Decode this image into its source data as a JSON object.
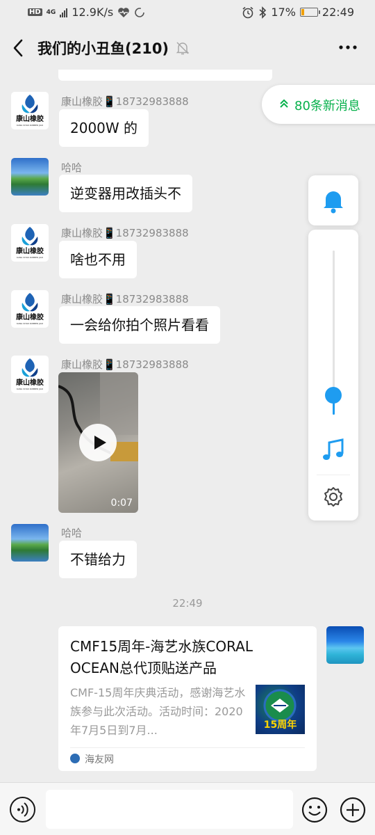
{
  "status_bar": {
    "network_badge": "HD",
    "network_type": "4G",
    "speed": "12.9K/s",
    "battery_percent": "17%",
    "battery_level": 0.17,
    "time": "22:49"
  },
  "header": {
    "title": "我们的小丑鱼(210)",
    "back_icon": "chevron-left-icon",
    "mute_icon": "bell-off-icon",
    "more_icon": "more-dots-icon"
  },
  "new_messages_pill": {
    "label": "80条新消息",
    "color": "#07b14c"
  },
  "messages": [
    {
      "sender": "康山橡胶📱18732983888",
      "text": "2000W 的",
      "avatar": "kangshan-logo"
    },
    {
      "sender": "哈哈",
      "text": "逆变器用改插头不",
      "avatar": "landscape"
    },
    {
      "sender": "康山橡胶📱18732983888",
      "text": "啥也不用",
      "avatar": "kangshan-logo"
    },
    {
      "sender": "康山橡胶📱18732983888",
      "text": "一会给你拍个照片看看",
      "avatar": "kangshan-logo"
    },
    {
      "sender": "康山橡胶📱18732983888",
      "video_duration": "0:07",
      "avatar": "kangshan-logo"
    },
    {
      "sender": "哈哈",
      "text": "不错给力",
      "avatar": "landscape"
    }
  ],
  "avatar_logo": {
    "brand": "康山橡胶",
    "subtext": "KANG SHAN RUBBER JIAO"
  },
  "timestamp": "22:49",
  "shared_card": {
    "title": "CMF15周年-海艺水族CORAL OCEAN总代顶贴送产品",
    "description": "CMF-15周年庆典活动，感谢海艺水族参与此次活动。活动时间：2020年7月5日到7月...",
    "thumb_text": "15周年",
    "source": "海友网"
  },
  "floating_widget": {
    "bell_icon": "bell-icon",
    "volume_level": 0.12,
    "music_icon": "music-note-icon",
    "settings_icon": "gear-icon",
    "accent": "#1e9cf0"
  },
  "input_bar": {
    "voice_icon": "voice-icon",
    "emoji_icon": "emoji-icon",
    "plus_icon": "plus-icon"
  }
}
